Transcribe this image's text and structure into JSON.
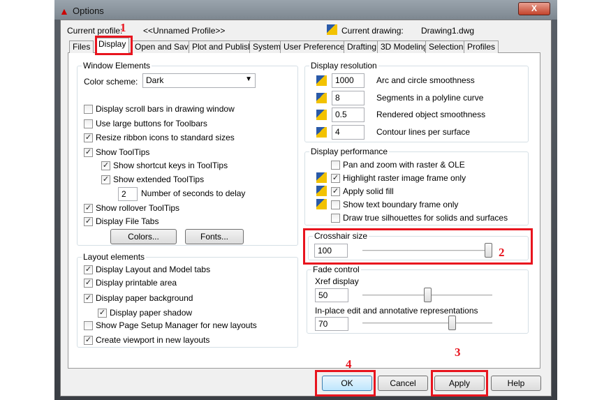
{
  "window": {
    "title": "Options",
    "close": "X"
  },
  "profile": {
    "label": "Current profile:",
    "value": "<<Unnamed Profile>>",
    "drawing_label": "Current drawing:",
    "drawing_value": "Drawing1.dwg"
  },
  "tabs": [
    "Files",
    "Display",
    "Open and Save",
    "Plot and Publish",
    "System",
    "User Preferences",
    "Drafting",
    "3D Modeling",
    "Selection",
    "Profiles"
  ],
  "window_elements": {
    "title": "Window Elements",
    "color_scheme_label": "Color scheme:",
    "color_scheme": "Dark",
    "checks": [
      {
        "label": "Display scroll bars in drawing window",
        "checked": false
      },
      {
        "label": "Use large buttons for Toolbars",
        "checked": false
      },
      {
        "label": "Resize ribbon icons to standard sizes",
        "checked": true
      },
      {
        "label": "Show ToolTips",
        "checked": true
      },
      {
        "label": "Show shortcut keys in ToolTips",
        "checked": true
      },
      {
        "label": "Show extended ToolTips",
        "checked": true
      },
      {
        "label": "Show rollover ToolTips",
        "checked": true
      },
      {
        "label": "Display File Tabs",
        "checked": true
      }
    ],
    "delay_value": "2",
    "delay_label": "Number of seconds to delay",
    "colors_btn": "Colors...",
    "fonts_btn": "Fonts..."
  },
  "layout_elements": {
    "title": "Layout elements",
    "checks": [
      {
        "label": "Display Layout and Model tabs",
        "checked": true
      },
      {
        "label": "Display printable area",
        "checked": true
      },
      {
        "label": "Display paper background",
        "checked": true
      },
      {
        "label": "Display paper shadow",
        "checked": true
      },
      {
        "label": "Show Page Setup Manager for new layouts",
        "checked": false
      },
      {
        "label": "Create viewport in new layouts",
        "checked": true
      }
    ]
  },
  "display_resolution": {
    "title": "Display resolution",
    "items": [
      {
        "value": "1000",
        "label": "Arc and circle smoothness"
      },
      {
        "value": "8",
        "label": "Segments in a polyline curve"
      },
      {
        "value": "0.5",
        "label": "Rendered object smoothness"
      },
      {
        "value": "4",
        "label": "Contour lines per surface"
      }
    ]
  },
  "display_performance": {
    "title": "Display performance",
    "checks": [
      {
        "label": "Pan and zoom with raster & OLE",
        "checked": false
      },
      {
        "label": "Highlight raster image frame only",
        "checked": true
      },
      {
        "label": "Apply solid fill",
        "checked": true
      },
      {
        "label": "Show text boundary frame only",
        "checked": false
      },
      {
        "label": "Draw true silhouettes for solids and surfaces",
        "checked": false
      }
    ]
  },
  "crosshair": {
    "title": "Crosshair size",
    "value": "100",
    "slider_percent": 100
  },
  "fade": {
    "title": "Fade control",
    "xref_label": "Xref display",
    "xref_value": "50",
    "xref_percent": 50,
    "inplace_label": "In-place edit and annotative representations",
    "inplace_value": "70",
    "inplace_percent": 70
  },
  "buttons": {
    "ok": "OK",
    "cancel": "Cancel",
    "apply": "Apply",
    "help": "Help"
  },
  "annotations": [
    "1",
    "2",
    "3",
    "4"
  ],
  "colors": {
    "highlight": "#e8141e"
  }
}
